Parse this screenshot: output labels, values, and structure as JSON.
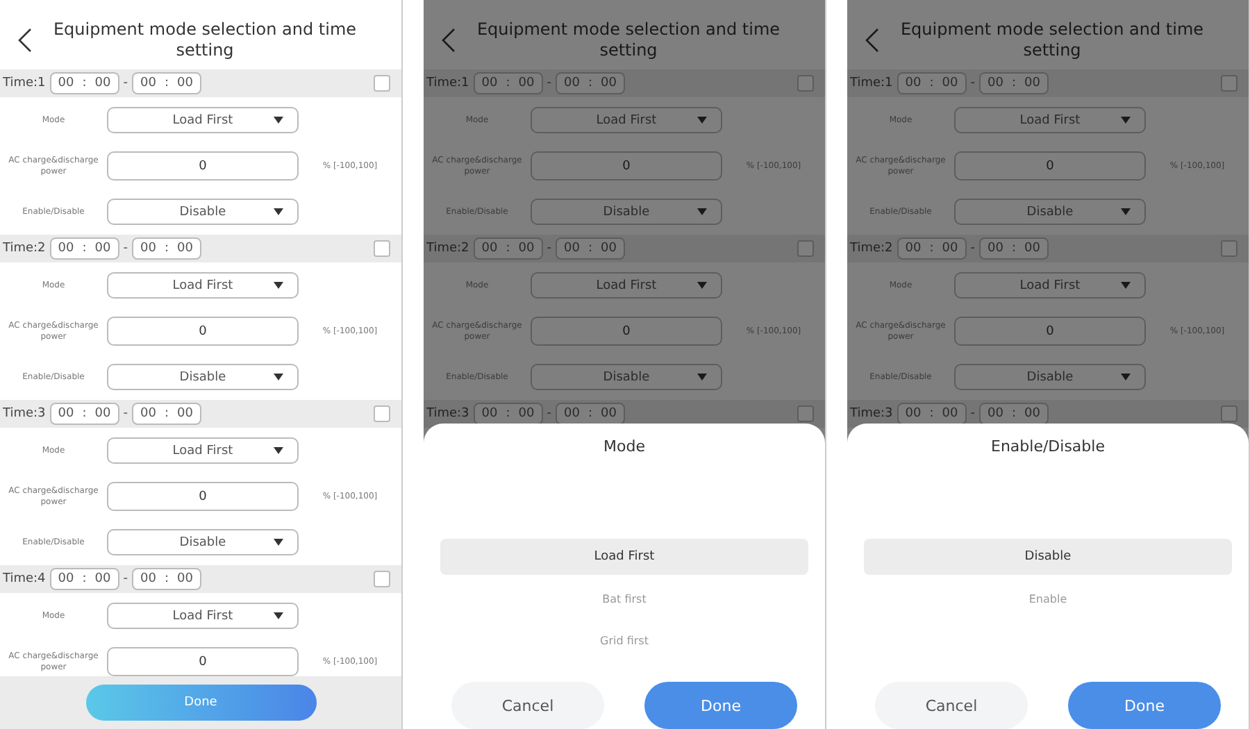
{
  "screens": [
    {
      "title": "Equipment mode selection and time setting",
      "dimmed": false,
      "slots": [
        {
          "label": "Time:1",
          "start": {
            "hour": "00",
            "sep": ":",
            "minute": "00"
          },
          "dash": "-",
          "end": {
            "hour": "00",
            "sep": ":",
            "minute": "00"
          },
          "checked": false,
          "rows": [
            {
              "kind": "select",
              "label": "Mode",
              "value": "Load First"
            },
            {
              "kind": "input",
              "label": "AC charge&discharge power",
              "value": "0",
              "unit": "% [-100,100]"
            },
            {
              "kind": "select",
              "label": "Enable/Disable",
              "value": "Disable"
            }
          ]
        },
        {
          "label": "Time:2",
          "start": {
            "hour": "00",
            "sep": ":",
            "minute": "00"
          },
          "dash": "-",
          "end": {
            "hour": "00",
            "sep": ":",
            "minute": "00"
          },
          "checked": false,
          "rows": [
            {
              "kind": "select",
              "label": "Mode",
              "value": "Load First"
            },
            {
              "kind": "input",
              "label": "AC charge&discharge power",
              "value": "0",
              "unit": "% [-100,100]"
            },
            {
              "kind": "select",
              "label": "Enable/Disable",
              "value": "Disable"
            }
          ]
        },
        {
          "label": "Time:3",
          "start": {
            "hour": "00",
            "sep": ":",
            "minute": "00"
          },
          "dash": "-",
          "end": {
            "hour": "00",
            "sep": ":",
            "minute": "00"
          },
          "checked": false,
          "rows": [
            {
              "kind": "select",
              "label": "Mode",
              "value": "Load First"
            },
            {
              "kind": "input",
              "label": "AC charge&discharge power",
              "value": "0",
              "unit": "% [-100,100]"
            },
            {
              "kind": "select",
              "label": "Enable/Disable",
              "value": "Disable"
            }
          ]
        },
        {
          "label": "Time:4",
          "start": {
            "hour": "00",
            "sep": ":",
            "minute": "00"
          },
          "dash": "-",
          "end": {
            "hour": "00",
            "sep": ":",
            "minute": "00"
          },
          "checked": false,
          "rows": [
            {
              "kind": "select",
              "label": "Mode",
              "value": "Load First"
            },
            {
              "kind": "input",
              "label": "AC charge&discharge power",
              "value": "0",
              "unit": "% [-100,100]"
            }
          ]
        }
      ],
      "footer_button": "Done"
    },
    {
      "title": "Equipment mode selection and time setting",
      "dimmed": true,
      "slots": [
        {
          "label": "Time:1",
          "start": {
            "hour": "00",
            "sep": ":",
            "minute": "00"
          },
          "dash": "-",
          "end": {
            "hour": "00",
            "sep": ":",
            "minute": "00"
          },
          "checked": false,
          "rows": [
            {
              "kind": "select",
              "label": "Mode",
              "value": "Load First"
            },
            {
              "kind": "input",
              "label": "AC charge&discharge power",
              "value": "0",
              "unit": "% [-100,100]"
            },
            {
              "kind": "select",
              "label": "Enable/Disable",
              "value": "Disable"
            }
          ]
        },
        {
          "label": "Time:2",
          "start": {
            "hour": "00",
            "sep": ":",
            "minute": "00"
          },
          "dash": "-",
          "end": {
            "hour": "00",
            "sep": ":",
            "minute": "00"
          },
          "checked": false,
          "rows": [
            {
              "kind": "select",
              "label": "Mode",
              "value": "Load First"
            },
            {
              "kind": "input",
              "label": "AC charge&discharge power",
              "value": "0",
              "unit": "% [-100,100]"
            },
            {
              "kind": "select",
              "label": "Enable/Disable",
              "value": "Disable"
            }
          ]
        },
        {
          "label": "Time:3",
          "start": {
            "hour": "00",
            "sep": ":",
            "minute": "00"
          },
          "dash": "-",
          "end": {
            "hour": "00",
            "sep": ":",
            "minute": "00"
          },
          "checked": false
        }
      ],
      "sheet": {
        "title": "Mode",
        "options": [
          {
            "label": "Load First",
            "selected": true
          },
          {
            "label": "Bat first",
            "selected": false
          },
          {
            "label": "Grid first",
            "selected": false
          }
        ],
        "cancel": "Cancel",
        "done": "Done"
      }
    },
    {
      "title": "Equipment mode selection and time setting",
      "dimmed": true,
      "slots": [
        {
          "label": "Time:1",
          "start": {
            "hour": "00",
            "sep": ":",
            "minute": "00"
          },
          "dash": "-",
          "end": {
            "hour": "00",
            "sep": ":",
            "minute": "00"
          },
          "checked": false,
          "rows": [
            {
              "kind": "select",
              "label": "Mode",
              "value": "Load First"
            },
            {
              "kind": "input",
              "label": "AC charge&discharge power",
              "value": "0",
              "unit": "% [-100,100]"
            },
            {
              "kind": "select",
              "label": "Enable/Disable",
              "value": "Disable"
            }
          ]
        },
        {
          "label": "Time:2",
          "start": {
            "hour": "00",
            "sep": ":",
            "minute": "00"
          },
          "dash": "-",
          "end": {
            "hour": "00",
            "sep": ":",
            "minute": "00"
          },
          "checked": false,
          "rows": [
            {
              "kind": "select",
              "label": "Mode",
              "value": "Load First"
            },
            {
              "kind": "input",
              "label": "AC charge&discharge power",
              "value": "0",
              "unit": "% [-100,100]"
            },
            {
              "kind": "select",
              "label": "Enable/Disable",
              "value": "Disable"
            }
          ]
        },
        {
          "label": "Time:3",
          "start": {
            "hour": "00",
            "sep": ":",
            "minute": "00"
          },
          "dash": "-",
          "end": {
            "hour": "00",
            "sep": ":",
            "minute": "00"
          },
          "checked": false
        }
      ],
      "sheet": {
        "title": "Enable/Disable",
        "options": [
          {
            "label": "Disable",
            "selected": true
          },
          {
            "label": "Enable",
            "selected": false
          }
        ],
        "cancel": "Cancel",
        "done": "Done"
      }
    }
  ]
}
